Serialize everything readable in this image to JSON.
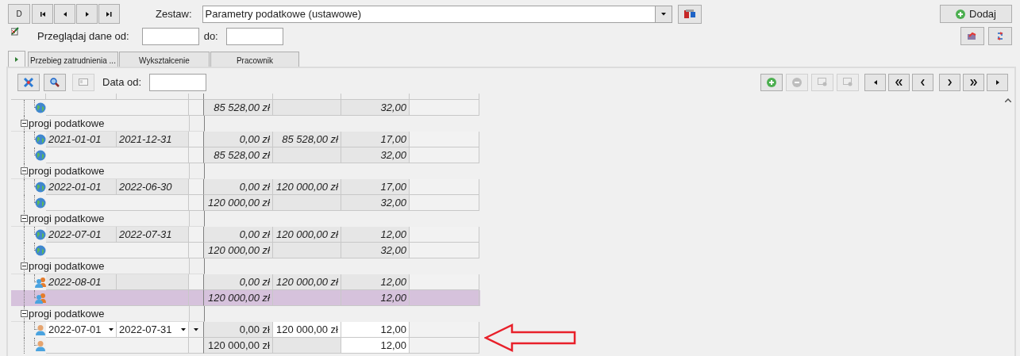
{
  "toolbar": {
    "record_button": "D",
    "set_label": "Zestaw:",
    "set_value": "Parametry podatkowe (ustawowe)",
    "add_button": "Dodaj"
  },
  "filter": {
    "from_label": "Przeglądaj dane od:",
    "to_label": "do:"
  },
  "tabs": [
    {
      "label": "Przebieg zatrudnienia ...",
      "selected": false
    },
    {
      "label": "Wykształcenie",
      "selected": false
    },
    {
      "label": "Pracownik",
      "selected": false
    }
  ],
  "grid": {
    "date_label": "Data od:",
    "rows": [
      {
        "kind": "globe",
        "selected": false,
        "editing": false,
        "amount_from": "85 528,00 zł",
        "rate": "32,00"
      },
      {
        "kind": "group",
        "label": "progi podatkowe",
        "expanded": true
      },
      {
        "kind": "globe",
        "selected": false,
        "editing": false,
        "date_from": "2021-01-01",
        "date_to": "2021-12-31",
        "amount_from": "0,00 zł",
        "amount_to": "85 528,00 zł",
        "rate": "17,00"
      },
      {
        "kind": "globe",
        "selected": false,
        "editing": false,
        "amount_from": "85 528,00 zł",
        "rate": "32,00"
      },
      {
        "kind": "group",
        "label": "progi podatkowe",
        "expanded": true
      },
      {
        "kind": "globe",
        "selected": false,
        "editing": false,
        "date_from": "2022-01-01",
        "date_to": "2022-06-30",
        "amount_from": "0,00 zł",
        "amount_to": "120 000,00 zł",
        "rate": "17,00"
      },
      {
        "kind": "globe",
        "selected": false,
        "editing": false,
        "amount_from": "120 000,00 zł",
        "rate": "32,00"
      },
      {
        "kind": "group",
        "label": "progi podatkowe",
        "expanded": true
      },
      {
        "kind": "globe",
        "selected": false,
        "editing": false,
        "date_from": "2022-07-01",
        "date_to": "2022-07-31",
        "amount_from": "0,00 zł",
        "amount_to": "120 000,00 zł",
        "rate": "12,00"
      },
      {
        "kind": "globe",
        "selected": false,
        "editing": false,
        "amount_from": "120 000,00 zł",
        "rate": "32,00"
      },
      {
        "kind": "group",
        "label": "progi podatkowe",
        "expanded": true
      },
      {
        "kind": "people",
        "selected": false,
        "editing": false,
        "date_from": "2022-08-01",
        "amount_from": "0,00 zł",
        "amount_to": "120 000,00 zł",
        "rate": "12,00"
      },
      {
        "kind": "people",
        "selected": true,
        "editing": false,
        "amount_from": "120 000,00 zł",
        "rate": "12,00"
      },
      {
        "kind": "group",
        "label": "progi podatkowe",
        "expanded": true
      },
      {
        "kind": "person",
        "selected": false,
        "editing": true,
        "date_from": "2022-07-01",
        "date_to": "2022-07-31",
        "amount_from": "0,00 zł",
        "amount_to": "120 000,00 zł",
        "rate": "12,00"
      },
      {
        "kind": "person",
        "selected": false,
        "editing": true,
        "amount_from": "120 000,00 zł",
        "rate": "12,00"
      }
    ]
  }
}
